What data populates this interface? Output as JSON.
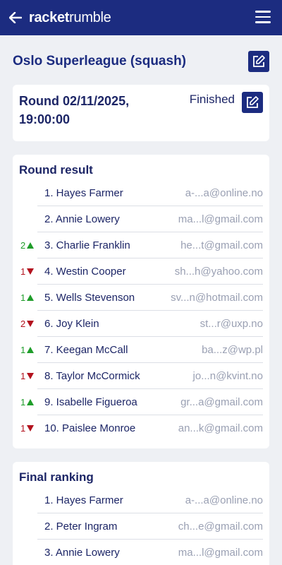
{
  "app": {
    "logo_bold": "racket",
    "logo_light": "rumble"
  },
  "league": {
    "title": "Oslo Superleague (squash)"
  },
  "round": {
    "title": "Round 02/11/2025, 19:00:00",
    "status": "Finished"
  },
  "round_result": {
    "title": "Round result",
    "rows": [
      {
        "move": "",
        "dir": "",
        "name": "1. Hayes Farmer",
        "email": "a-...a@online.no"
      },
      {
        "move": "",
        "dir": "",
        "name": "2. Annie Lowery",
        "email": "ma...l@gmail.com"
      },
      {
        "move": "2",
        "dir": "up",
        "name": "3. Charlie Franklin",
        "email": "he...t@gmail.com"
      },
      {
        "move": "1",
        "dir": "down",
        "name": "4. Westin Cooper",
        "email": "sh...h@yahoo.com"
      },
      {
        "move": "1",
        "dir": "up",
        "name": "5. Wells Stevenson",
        "email": "sv...n@hotmail.com"
      },
      {
        "move": "2",
        "dir": "down",
        "name": "6. Joy Klein",
        "email": "st...r@uxp.no"
      },
      {
        "move": "1",
        "dir": "up",
        "name": "7. Keegan McCall",
        "email": "ba...z@wp.pl"
      },
      {
        "move": "1",
        "dir": "down",
        "name": "8. Taylor McCormick",
        "email": "jo...n@kvint.no"
      },
      {
        "move": "1",
        "dir": "up",
        "name": "9. Isabelle Figueroa",
        "email": "gr...a@gmail.com"
      },
      {
        "move": "1",
        "dir": "down",
        "name": "10. Paislee Monroe",
        "email": "an...k@gmail.com"
      }
    ]
  },
  "final_ranking": {
    "title": "Final ranking",
    "rows": [
      {
        "move": "",
        "dir": "",
        "name": "1. Hayes Farmer",
        "email": "a-...a@online.no"
      },
      {
        "move": "",
        "dir": "",
        "name": "2. Peter Ingram",
        "email": "ch...e@gmail.com"
      },
      {
        "move": "",
        "dir": "",
        "name": "3. Annie Lowery",
        "email": "ma...l@gmail.com"
      }
    ]
  },
  "colors": {
    "brand": "#1c2c80",
    "up": "#1f9d2a",
    "down": "#b3121e",
    "muted": "#9aa0b3"
  }
}
